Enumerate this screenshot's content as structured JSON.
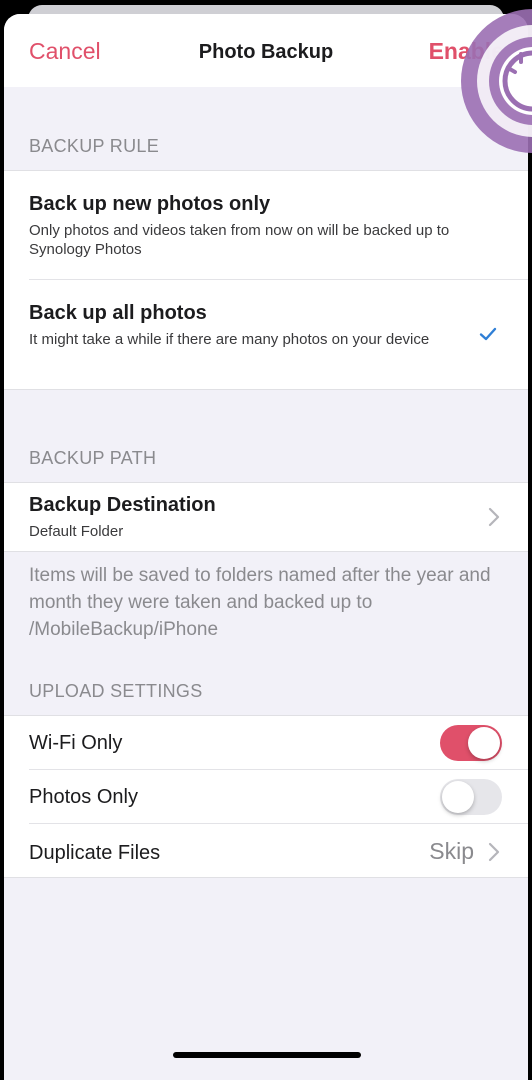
{
  "nav": {
    "cancel_label": "Cancel",
    "title": "Photo Backup",
    "enable_label": "Enable"
  },
  "backup_rule": {
    "header": "BACKUP RULE",
    "options": [
      {
        "title": "Back up new photos only",
        "subtitle": "Only photos and videos taken from now on will be backed up to Synology Photos",
        "selected": false
      },
      {
        "title": "Back up all photos",
        "subtitle": "It might take a while if there are many photos on your device",
        "selected": true
      }
    ]
  },
  "backup_path": {
    "header": "BACKUP PATH",
    "destination_title": "Backup Destination",
    "destination_value": "Default Folder",
    "footnote": "Items will be saved to folders named after the year and month they were taken and backed up to /MobileBackup/iPhone"
  },
  "upload_settings": {
    "header": "UPLOAD SETTINGS",
    "items": [
      {
        "label": "Wi-Fi Only",
        "enabled": true
      },
      {
        "label": "Photos Only",
        "enabled": false
      }
    ],
    "duplicate_label": "Duplicate Files",
    "duplicate_value": "Skip"
  },
  "colors": {
    "accent": "#e0506a",
    "checkmark": "#2f7fd6",
    "overlay": "#9b6fb2"
  }
}
